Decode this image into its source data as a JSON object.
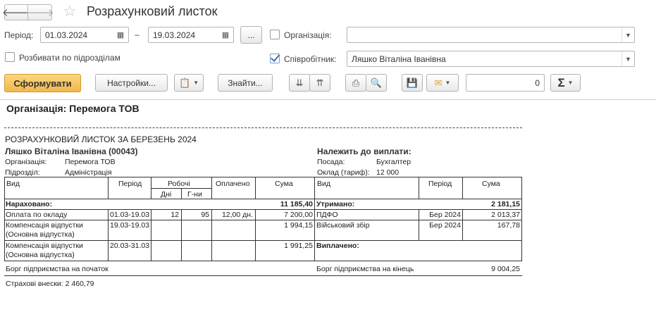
{
  "window": {
    "title": "Розрахунковий листок"
  },
  "nav": {
    "back_glyph": "🡐",
    "forward_glyph": "🡒",
    "star_glyph": "☆"
  },
  "filters": {
    "period_label": "Період:",
    "date_from": "01.03.2024",
    "date_dash": "–",
    "date_to": "19.03.2024",
    "period_choose": "...",
    "org_label": "Організація:",
    "org_value": "",
    "split_label": "Розбивати по підрозділам",
    "employee_label": "Співробітник:",
    "employee_value": "Ляшко Віталіна Іванівна"
  },
  "toolbar": {
    "generate": "Сформувати",
    "settings": "Настройки...",
    "find": "Знайти...",
    "count_value": "0",
    "sum_glyph": "Σ"
  },
  "report": {
    "org_header": "Організація: Перемога ТОВ",
    "doc_title": "РОЗРАХУНКОВИЙ ЛИСТОК ЗА БЕРЕЗЕНЬ 2024",
    "employee": "Ляшко Віталіна Іванівна (00043)",
    "due_label": "Належить до виплати:",
    "org_key": "Організація:",
    "org_val": "Перемога ТОВ",
    "dept_key": "Підрозділ:",
    "dept_val": "Адміністрація",
    "position_key": "Посада:",
    "position_val": "Бухгалтер",
    "salary_key": "Оклад (тариф):",
    "salary_val": "12 000",
    "headers": {
      "kind": "Вид",
      "period": "Період",
      "working": "Робочі",
      "days": "Дні",
      "hours": "Г-ни",
      "paid": "Оплачено",
      "sum": "Сума",
      "kind2": "Вид",
      "period2": "Період",
      "sum2": "Сума"
    },
    "accrued_label": "Нараховано:",
    "accrued_total": "11 185,40",
    "withheld_label": "Утримано:",
    "withheld_total": "2 181,15",
    "rows": [
      {
        "kind": "Оплата по окладу",
        "period": "01.03-19.03",
        "days": "12",
        "hours": "95",
        "paid": "12,00 дн.",
        "sum": "7 200,00",
        "kind2": "ПДФО",
        "period2": "Бер 2024",
        "sum2": "2 013,37"
      },
      {
        "kind": "Компенсація відпустки (Основна відпустка)",
        "kind_l1": "Компенсація відпустки",
        "kind_l2": "(Основна відпустка)",
        "period": "19.03-19.03",
        "days": "",
        "hours": "",
        "paid": "",
        "sum": "1 994,15",
        "kind2": "Військовий збір",
        "period2": "Бер 2024",
        "sum2": "167,78"
      },
      {
        "kind": "Компенсація відпустки (Основна відпустка)",
        "kind_l1": "Компенсація відпустки",
        "kind_l2": "(Основна відпустка)",
        "period": "20.03-31.03",
        "days": "",
        "hours": "",
        "paid": "",
        "sum": "1 991,25",
        "kind2": "Виплачено:",
        "period2": "",
        "sum2": ""
      }
    ],
    "debt_start_label": "Борг підприємства на початок",
    "debt_end_label": "Борг підприємства на кінець",
    "debt_end_val": "9 004,25",
    "insurance": "Страхові внески: 2 460,79"
  },
  "colors": {
    "primary_button": "#f1b84c",
    "check": "#3b73b5"
  }
}
